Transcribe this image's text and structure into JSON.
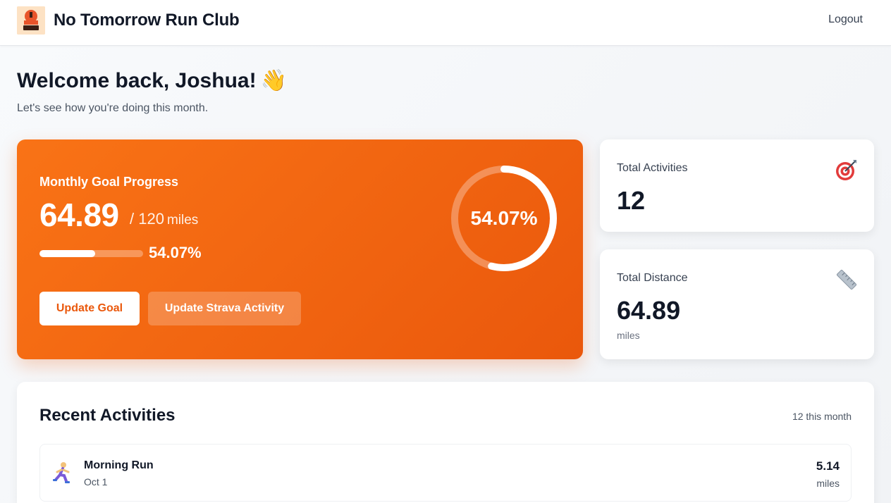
{
  "header": {
    "brand": "No Tomorrow Run Club",
    "logo_text": "RUN CLUB",
    "logout_label": "Logout"
  },
  "welcome": {
    "title": "Welcome back, Joshua!",
    "wave_icon": "👋",
    "subtitle": "Let's see how you're doing this month."
  },
  "goal": {
    "label": "Monthly Goal Progress",
    "current": "64.89",
    "target": "/ 120",
    "unit": "miles",
    "percent_text": "54.07%",
    "ring_text": "54.07%",
    "progress_fraction": 0.5407,
    "update_goal_label": "Update Goal",
    "update_strava_label": "Update Strava Activity"
  },
  "stats": {
    "activities": {
      "label": "Total Activities",
      "value": "12",
      "icon": "target-icon"
    },
    "distance": {
      "label": "Total Distance",
      "value": "64.89",
      "unit": "miles",
      "icon": "ruler-icon"
    }
  },
  "recent": {
    "title": "Recent Activities",
    "count_text": "12 this month",
    "items": [
      {
        "name": "Morning Run",
        "date": "Oct 1",
        "distance": "5.14",
        "unit": "miles",
        "icon": "runner-icon"
      }
    ]
  },
  "colors": {
    "accent": "#f97316",
    "accent_dark": "#ea580c"
  }
}
